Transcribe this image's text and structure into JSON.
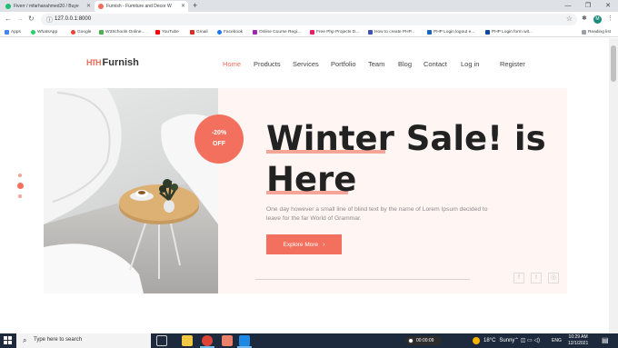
{
  "browser": {
    "tabs": [
      {
        "title": "Fiverr / mfarhanahmed20 / Buye",
        "color": "#1dbf73",
        "active": false
      },
      {
        "title": "Furnish - Furniture and Decor W",
        "color": "#f26b5b",
        "active": true
      }
    ],
    "new_tab": "+",
    "window_controls": {
      "minimize": "—",
      "maximize": "❐",
      "close": "✕"
    },
    "back": "←",
    "forward": "→",
    "reload": "↻",
    "address_info_icon": "ⓘ",
    "url": "127.0.0.1:8000",
    "bookmark_star": "☆",
    "extensions_icon": "✱",
    "menu_icon": "⋮",
    "profile_initial": "M",
    "bookmarks": [
      {
        "label": "Apps",
        "color": "#4285f4"
      },
      {
        "label": "WhatsApp",
        "color": "#25d366"
      },
      {
        "label": "Google",
        "color": "#ea4335"
      },
      {
        "label": "W3Schools Online...",
        "color": "#4caf50"
      },
      {
        "label": "YouTube",
        "color": "#ff0000"
      },
      {
        "label": "Gmail",
        "color": "#d93025"
      },
      {
        "label": "Facebook",
        "color": "#1877f2"
      },
      {
        "label": "Online Course Regi...",
        "color": "#9c27b0"
      },
      {
        "label": "Free Php Projects D...",
        "color": "#e91e63"
      },
      {
        "label": "How to create PHP...",
        "color": "#3f51b5"
      },
      {
        "label": "PHP Login logout e...",
        "color": "#1565c0"
      },
      {
        "label": "PHP Login form wit...",
        "color": "#0d47a1"
      }
    ],
    "reading_list": "Reading list"
  },
  "site": {
    "logo_mark": "HTH",
    "logo_text": "Furnish",
    "nav": [
      "Home",
      "Products",
      "Services",
      "Portfolio",
      "Team",
      "Blog",
      "Contact",
      "Log in",
      "Register"
    ],
    "active_nav": "Home",
    "badge_line1": "-20%",
    "badge_line2": "OFF",
    "headline_line1": "Winter Sale! is",
    "headline_line2": "Here",
    "lead": "One day however a small line of blind text by the name of Lorem Ipsum decided to leave for the far World of Grammar.",
    "cta_label": "Explore More",
    "cta_arrow": "›",
    "social": [
      "f",
      "t",
      "◎"
    ],
    "accent": "#f4705e"
  },
  "taskbar": {
    "search_placeholder": "Type here to search",
    "search_icon": "⌕",
    "recorder_time": "00:00:09",
    "temperature": "18°C",
    "weather": "Sunny",
    "tray_icons": "⌃  ◫  ▭  ◁)",
    "language": "ENG",
    "time": "10:29 AM",
    "date": "12/1/2021",
    "notification_icon": "▤"
  }
}
